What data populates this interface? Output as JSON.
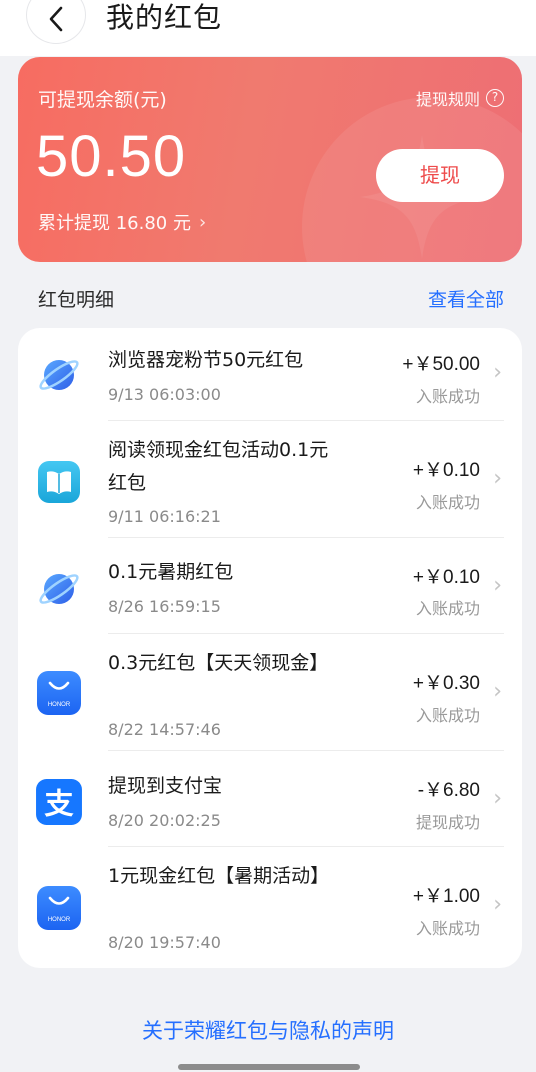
{
  "header": {
    "title": "我的红包"
  },
  "balance": {
    "label": "可提现余额(元)",
    "rules_label": "提现规则",
    "amount": "50.50",
    "withdraw_label": "提现",
    "total_withdrawn": "累计提现 16.80 元"
  },
  "details": {
    "title": "红包明细",
    "view_all": "查看全部",
    "items": [
      {
        "title": "浏览器宠粉节50元红包",
        "time": "9/13 06:03:00",
        "amount": "+￥50.00",
        "status": "入账成功",
        "icon": "planet-icon"
      },
      {
        "title": "阅读领现金红包活动0.1元红包",
        "time": "9/11 06:16:21",
        "amount": "+￥0.10",
        "status": "入账成功",
        "icon": "book-icon"
      },
      {
        "title": "0.1元暑期红包",
        "time": "8/26 16:59:15",
        "amount": "+￥0.10",
        "status": "入账成功",
        "icon": "planet-icon"
      },
      {
        "title": "0.3元红包【天天领现金】",
        "time": "8/22 14:57:46",
        "amount": "+￥0.30",
        "status": "入账成功",
        "icon": "honor-shop-icon"
      },
      {
        "title": "提现到支付宝",
        "time": "8/20 20:02:25",
        "amount": "-￥6.80",
        "status": "提现成功",
        "icon": "alipay-icon"
      },
      {
        "title": "1元现金红包【暑期活动】",
        "time": "8/20 19:57:40",
        "amount": "+￥1.00",
        "status": "入账成功",
        "icon": "honor-shop-icon"
      }
    ]
  },
  "footer": {
    "privacy_link": "关于荣耀红包与隐私的声明",
    "honor_brand": "HONOR",
    "alipay_glyph": "支"
  }
}
